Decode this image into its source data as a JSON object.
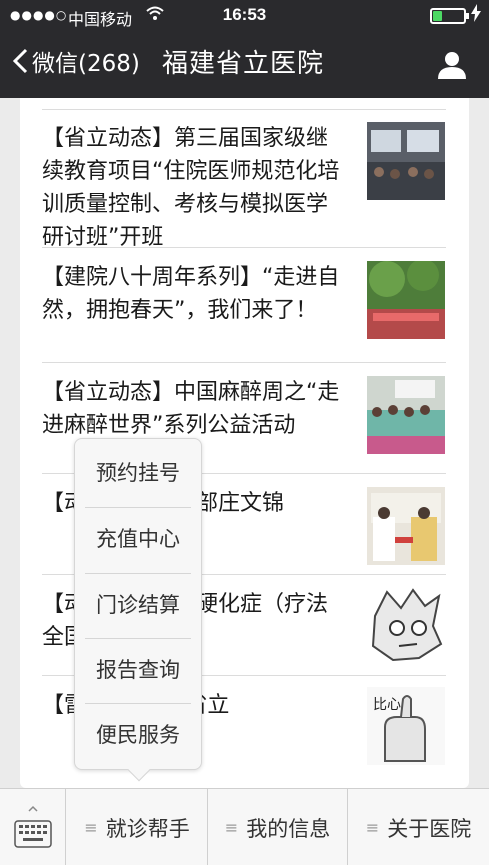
{
  "status_bar": {
    "signal": "●●●●○",
    "carrier": "中国移动",
    "time": "16:53"
  },
  "nav_bar": {
    "back_label": "微信(268)",
    "title": "福建省立医院"
  },
  "articles": [
    {
      "title": "【省立动态】第三届国家级继续教育项目“住院医师规范化培训质量控制、考核与模拟医学研讨班”开班"
    },
    {
      "title": "【建院八十周年系列】“走进自然，拥抱春天”，我们来了！"
    },
    {
      "title": "【省立动态】中国麻醉周之“走进麻醉世界”系列公益活动"
    },
    {
      "title": "【动态】援疆干部庄文锦"
    },
    {
      "title": "【动态】系统性硬化症（疗法全国首发"
    },
    {
      "title": "【雷锋月”里的省立"
    }
  ],
  "popup_menu": {
    "items": [
      "预约挂号",
      "充值中心",
      "门诊结算",
      "报告查询",
      "便民服务"
    ]
  },
  "bottom_menu": {
    "tabs": [
      "就诊帮手",
      "我的信息",
      "关于医院"
    ]
  },
  "colors": {
    "header_bg": "#2a2a2d",
    "battery_fill": "#4cd964",
    "page_bg": "#ebebeb"
  }
}
